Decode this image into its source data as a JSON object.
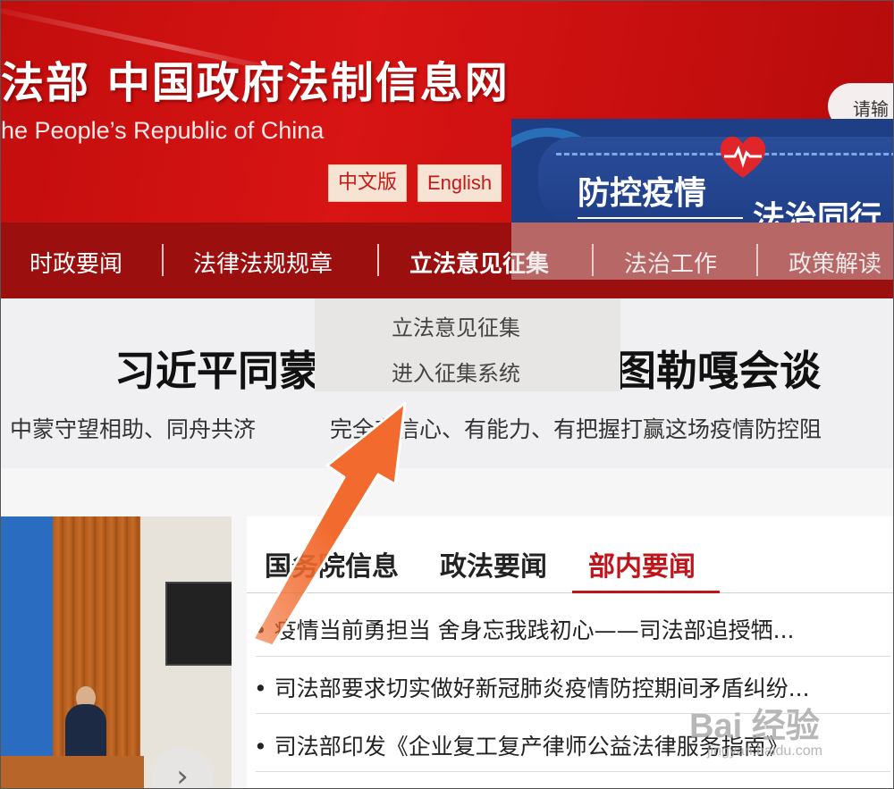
{
  "header": {
    "title": "法部  中国政府法制信息网",
    "subtitle": "he People’s Republic of China",
    "lang_chinese": "中文版",
    "lang_english": "English",
    "search_placeholder": "请输"
  },
  "banner": {
    "line1": "防控疫情",
    "line2": "法治同行"
  },
  "nav": {
    "items": [
      "时政要闻",
      "法律法规规章",
      "立法意见征集",
      "法治工作",
      "政策解读"
    ]
  },
  "dropdown": {
    "items": [
      "立法意见征集",
      "进入征集系统"
    ]
  },
  "headline": {
    "title_left": "习近平同蒙",
    "title_right": "图勒嘎会谈",
    "sub_left": "中蒙守望相助、同舟共济",
    "sub_right": "完全有信心、有能力、有把握打赢这场疫情防控阻"
  },
  "news": {
    "tabs": [
      "国务院信息",
      "政法要闻",
      "部内要闻"
    ],
    "active_tab": "部内要闻",
    "rows": [
      "疫情当前勇担当 舍身忘我践初心——司法部追授牺...",
      "司法部要求切实做好新冠肺炎疫情防控期间矛盾纠纷...",
      "司法部印发《企业复工复产律师公益法律服务指南》"
    ]
  },
  "watermark": {
    "brand": "Bai 经验",
    "url": "jingyan.baidu.com"
  },
  "colors": {
    "header_red": "#d81414",
    "nav_red": "#9c0f0f",
    "accent_red": "#c0141b",
    "arrow_orange": "#f26a2e"
  }
}
